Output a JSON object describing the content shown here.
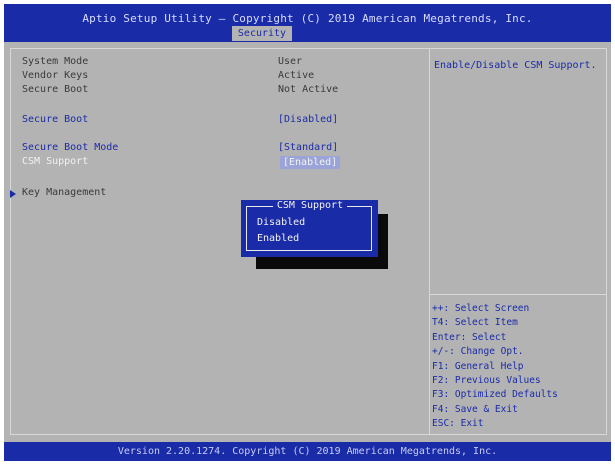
{
  "header": {
    "title": "Aptio Setup Utility – Copyright (C) 2019 American Megatrends, Inc.",
    "active_tab": "Security"
  },
  "main": {
    "info": [
      {
        "label": "System Mode",
        "value": "User"
      },
      {
        "label": "Vendor Keys",
        "value": "Active"
      },
      {
        "label": "Secure Boot",
        "value": "Not Active"
      }
    ],
    "secure_boot": {
      "label": "Secure Boot",
      "value": "[Disabled]"
    },
    "secure_boot_mode": {
      "label": "Secure Boot Mode",
      "value": "[Standard]"
    },
    "csm_support": {
      "label": "CSM Support",
      "value": "[Enabled]"
    },
    "key_management": {
      "label": "Key Management"
    }
  },
  "popup": {
    "title": "CSM Support",
    "options": [
      "Disabled",
      "Enabled"
    ]
  },
  "help": {
    "description": "Enable/Disable CSM Support.",
    "keys": [
      "++: Select Screen",
      "T4: Select Item",
      "Enter: Select",
      "+/-: Change Opt.",
      "F1: General Help",
      "F2: Previous Values",
      "F3: Optimized Defaults",
      "F4: Save & Exit",
      "ESC: Exit"
    ]
  },
  "footer": {
    "text": "Version 2.20.1274. Copyright (C) 2019 American Megatrends, Inc."
  },
  "colors": {
    "bios_blue": "#1a2ba8",
    "bios_gray": "#b3b3b3"
  }
}
